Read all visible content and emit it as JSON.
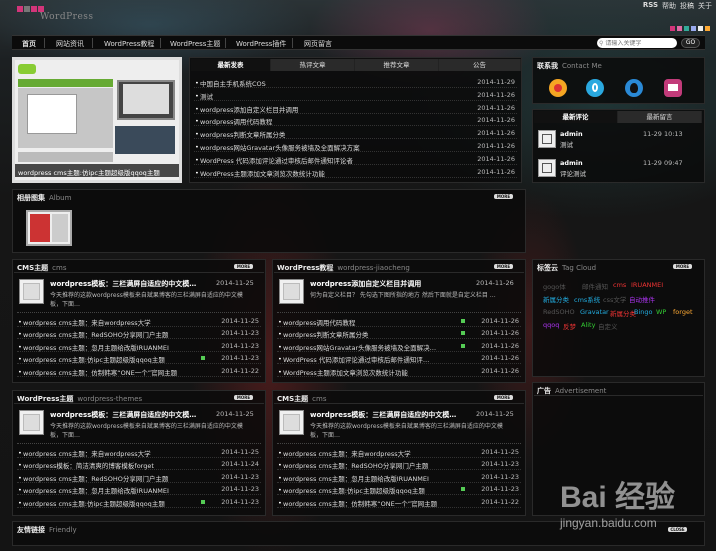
{
  "header": {
    "logo_text": "WordPress",
    "top_links": [
      "RSS",
      "帮助",
      "投稿",
      "关于"
    ],
    "swatches": [
      "#d3357a",
      "#e26aa5",
      "#3a9",
      "#9ae",
      "#eee",
      "#fa3"
    ]
  },
  "nav": {
    "items": [
      "首页",
      "网站资讯",
      "WordPress教程",
      "WordPress主题",
      "WordPress插件",
      "网页留言"
    ],
    "search_placeholder": "请输入关键字",
    "search_button": "GO"
  },
  "slider": {
    "caption": "wordpress cms主题:仿ipc主题超级版qqoq主题"
  },
  "latest": {
    "tabs": [
      "最新发表",
      "热评文章",
      "推荐文章",
      "公告"
    ],
    "items": [
      {
        "title": "中国自主手机系统COS",
        "date": "2014-11-29"
      },
      {
        "title": "测试",
        "date": "2014-11-26"
      },
      {
        "title": "wordpress添加自定义栏目并调用",
        "date": "2014-11-26"
      },
      {
        "title": "wordpress调用代码教程",
        "date": "2014-11-26"
      },
      {
        "title": "wordpress判断文章所属分类",
        "date": "2014-11-26"
      },
      {
        "title": "wordpress网站Gravatar头像服务被墙及全面解决方案",
        "date": "2014-11-26"
      },
      {
        "title": "WordPress 代码添加评论通过审核后邮件通知评论者",
        "date": "2014-11-26"
      },
      {
        "title": "WordPress主题添加文章浏览次数统计功能",
        "date": "2014-11-26"
      }
    ]
  },
  "contact": {
    "title": "联系我",
    "sub": "Contact Me",
    "icons": [
      "weibo-icon",
      "tencent-weibo-icon",
      "qq-icon",
      "email-icon"
    ]
  },
  "comments": {
    "tabs": [
      "最新评论",
      "最新留言"
    ],
    "items": [
      {
        "author": "admin",
        "date": "11-29 10:13",
        "text": "测试"
      },
      {
        "author": "admin",
        "date": "11-29 09:47",
        "text": "评论测试"
      }
    ]
  },
  "album": {
    "title": "相册图集",
    "sub": "Album",
    "more": "MORE"
  },
  "cms1": {
    "title": "CMS主题",
    "sub": "cms",
    "more": "MORE",
    "feature": {
      "title": "wordpress模板：三栏满屏自适应的中文模…",
      "date": "2014-11-25",
      "desc": "今天推荐的这款wordpress模板来自斌果博客的三栏满屏自适应的中文模板，下面…"
    },
    "items": [
      {
        "title": "wordpress cms主题：来自wordpress大学",
        "date": "2014-11-25"
      },
      {
        "title": "wordpress cms主题：RedSOHO分享网门户主题",
        "date": "2014-11-23"
      },
      {
        "title": "wordpress cms主题：忽月主题给改版IRUANMEI",
        "date": "2014-11-23"
      },
      {
        "title": "wordpress cms主题:仿ipc主题超级版qqoq主题",
        "date": "2014-11-23"
      },
      {
        "title": "wordpress cms主题：仿制韩寒“ONE一个”官网主题",
        "date": "2014-11-22"
      }
    ]
  },
  "tutorial": {
    "title": "WordPress教程",
    "sub": "wordpress-jiaocheng",
    "more": "MORE",
    "feature": {
      "title": "wordpress添加自定义栏目并调用",
      "date": "2014-11-26",
      "desc": "何为自定义栏目？ 先勾选下图所指的地方 然后下面就是自定义栏目 …"
    },
    "items": [
      {
        "title": "wordpress调用代码教程",
        "date": "2014-11-26"
      },
      {
        "title": "wordpress判断文章所属分类",
        "date": "2014-11-26"
      },
      {
        "title": "wordpress网站Gravatar头像服务被墙及全面解决…",
        "date": "2014-11-26"
      },
      {
        "title": "WordPress 代码添加评论通过审核后邮件通知评…",
        "date": "2014-11-26"
      },
      {
        "title": "WordPress主题添加文章浏览次数统计功能",
        "date": "2014-11-26"
      }
    ]
  },
  "tags": {
    "title": "标签云",
    "sub": "Tag Cloud",
    "more": "MORE",
    "items": [
      {
        "text": "gogo体",
        "color": "#555"
      },
      {
        "text": "邮件通知",
        "color": "#555"
      },
      {
        "text": "cms",
        "color": "#e33"
      },
      {
        "text": "IRUANMEI",
        "color": "#e33"
      },
      {
        "text": "新属分类",
        "color": "#2ad"
      },
      {
        "text": "cms系统",
        "color": "#2ad"
      },
      {
        "text": "css文学",
        "color": "#555"
      },
      {
        "text": "自动推件",
        "color": "#a3e"
      },
      {
        "text": "RedSOHO",
        "color": "#555"
      },
      {
        "text": "Gravatar",
        "color": "#2ad"
      },
      {
        "text": "新属分类",
        "color": "#e33"
      },
      {
        "text": "Bingo",
        "color": "#2ad"
      },
      {
        "text": "WP",
        "color": "#3c3"
      },
      {
        "text": "forget",
        "color": "#fa3"
      },
      {
        "text": "qqoq",
        "color": "#a3e"
      },
      {
        "text": "反梦",
        "color": "#e33"
      },
      {
        "text": "Ality",
        "color": "#3c3"
      },
      {
        "text": "自定义",
        "color": "#555"
      }
    ]
  },
  "themes": {
    "title": "WordPress主题",
    "sub": "wordpress-themes",
    "more": "MORE",
    "feature": {
      "title": "wordpress模板：三栏满屏自适应的中文模…",
      "date": "2014-11-25",
      "desc": "今天推荐的这款wordpress模板来自斌果博客的三栏满屏自适应的中文模板，下面…"
    },
    "items": [
      {
        "title": "wordpress cms主题：来自wordpress大学",
        "date": "2014-11-25"
      },
      {
        "title": "wordpress模板：简洁清爽的博客模板forget",
        "date": "2014-11-24"
      },
      {
        "title": "wordpress cms主题：RedSOHO分享网门户主题",
        "date": "2014-11-23"
      },
      {
        "title": "wordpress cms主题：忽月主题给改版IRUANMEI",
        "date": "2014-11-23"
      },
      {
        "title": "wordpress cms主题:仿ipc主题超级版qqoq主题",
        "date": "2014-11-23"
      }
    ]
  },
  "cms2": {
    "title": "CMS主题",
    "sub": "cms",
    "more": "MORE",
    "feature": {
      "title": "wordpress模板：三栏满屏自适应的中文模…",
      "date": "2014-11-25",
      "desc": "今天推荐的这款wordpress模板来自斌果博客的三栏满屏自适应的中文模板，下面…"
    },
    "items": [
      {
        "title": "wordpress cms主题：来自wordpress大学",
        "date": "2014-11-25"
      },
      {
        "title": "wordpress cms主题：RedSOHO分享网门户主题",
        "date": "2014-11-23"
      },
      {
        "title": "wordpress cms主题：忽月主题给改版IRUANMEI",
        "date": "2014-11-23"
      },
      {
        "title": "wordpress cms主题:仿ipc主题超级版qqoq主题",
        "date": "2014-11-23"
      },
      {
        "title": "wordpress cms主题：仿制韩寒“ONE一个”官网主题",
        "date": "2014-11-22"
      }
    ]
  },
  "ads": {
    "title": "广告",
    "sub": "Advertisement"
  },
  "friends": {
    "title": "友情链接",
    "sub": "Friendly",
    "more": "CLOSE"
  },
  "watermark": {
    "brand": "Bai 经验",
    "url": "jingyan.baidu.com"
  }
}
